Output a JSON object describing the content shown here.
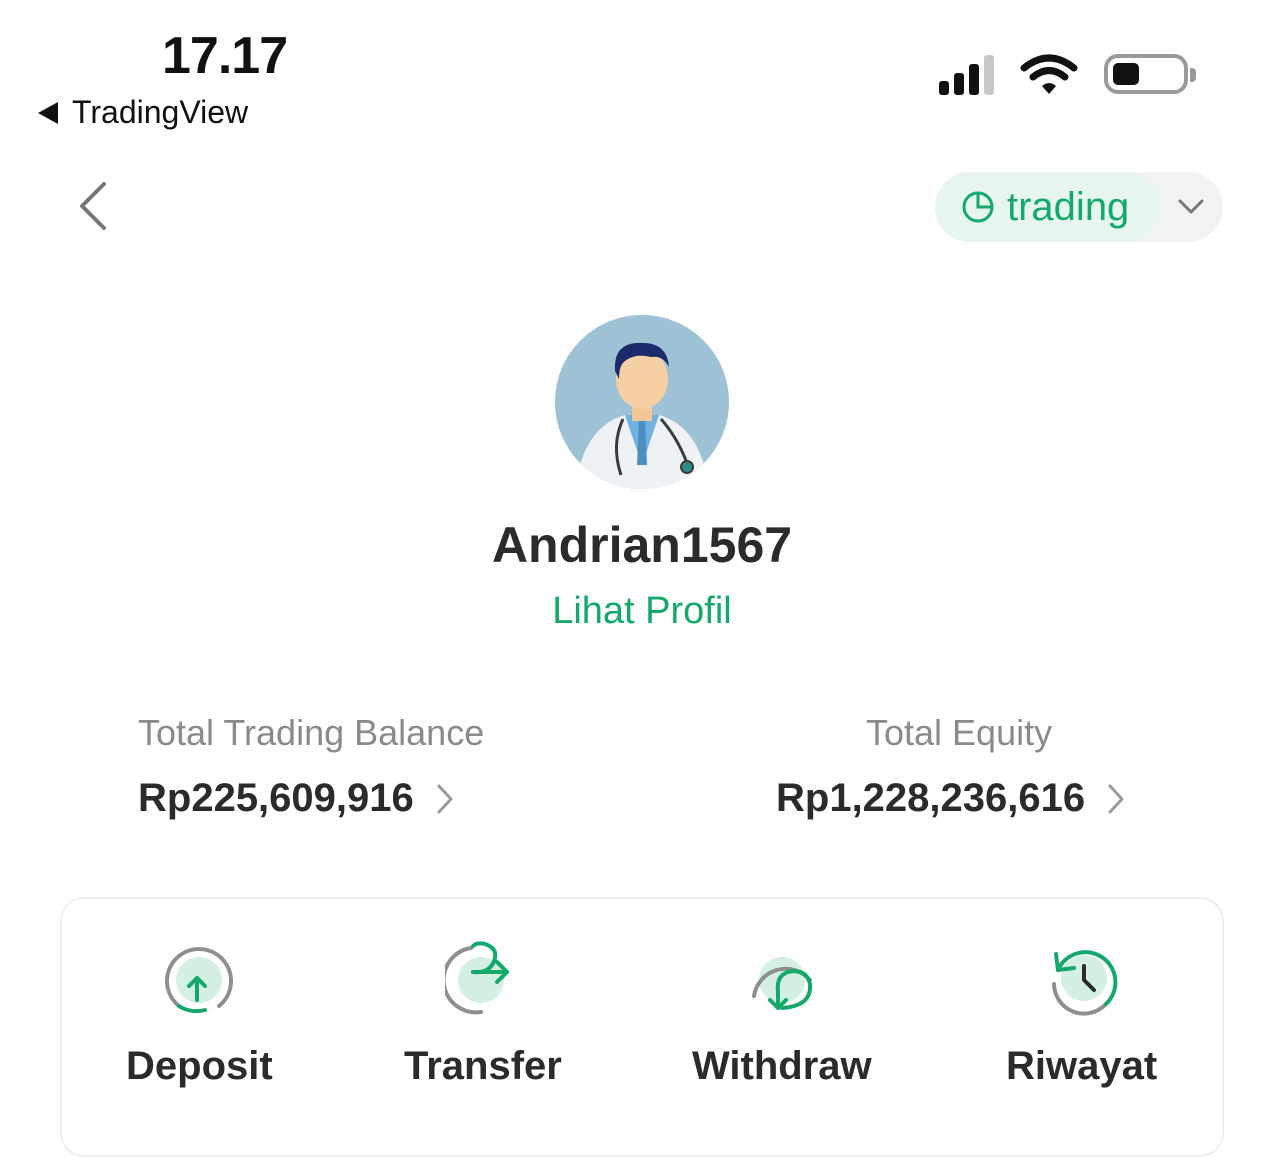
{
  "status_bar": {
    "time": "17.17",
    "back_app": "TradingView"
  },
  "header": {
    "account_label": "trading"
  },
  "profile": {
    "username": "Andrian1567",
    "view_profile": "Lihat Profil"
  },
  "balances": {
    "trading_balance": {
      "label": "Total Trading Balance",
      "value": "Rp225,609,916"
    },
    "equity": {
      "label": "Total Equity",
      "value": "Rp1,228,236,616"
    }
  },
  "actions": [
    {
      "label": "Deposit",
      "icon": "deposit-icon"
    },
    {
      "label": "Transfer",
      "icon": "transfer-icon"
    },
    {
      "label": "Withdraw",
      "icon": "withdraw-icon"
    },
    {
      "label": "Riwayat",
      "icon": "history-icon"
    }
  ],
  "colors": {
    "accent": "#14a86a",
    "accent_light": "#d4f0e2",
    "text": "#2b2b2b",
    "muted": "#8a8a8a"
  }
}
